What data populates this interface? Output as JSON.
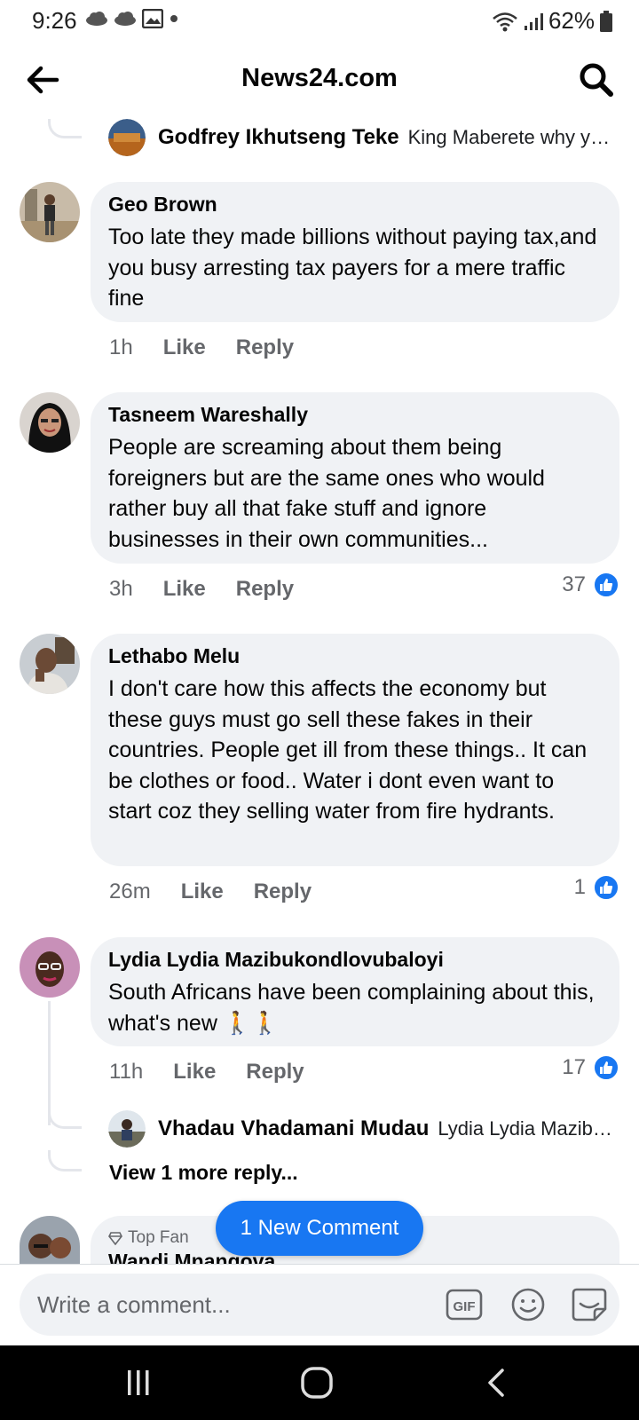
{
  "status_bar": {
    "time": "9:26",
    "battery": "62%"
  },
  "header": {
    "title": "News24.com"
  },
  "top_reply_preview": {
    "name": "Godfrey Ikhutseng Teke",
    "text": "King Maberete why yo…"
  },
  "comments": [
    {
      "author": "Geo Brown",
      "text": "Too late they made billions without paying tax,and you busy arresting tax payers for a mere traffic fine",
      "time": "1h",
      "like_label": "Like",
      "reply_label": "Reply",
      "reactions": ""
    },
    {
      "author": "Tasneem Wareshally",
      "text": "People are screaming about them being foreigners but are the same ones who would rather buy all that fake stuff and ignore businesses in their own communities...",
      "time": "3h",
      "like_label": "Like",
      "reply_label": "Reply",
      "reactions": "37"
    },
    {
      "author": "Lethabo Melu",
      "text": "I don't care how this affects the economy but these guys must go sell these fakes in their countries. People get ill from these things.. It can be clothes or food.. Water i dont even want to start coz they selling water from fire hydrants.",
      "time": "26m",
      "like_label": "Like",
      "reply_label": "Reply",
      "reactions": "1"
    },
    {
      "author": "Lydia Lydia Mazibukondlovubaloyi",
      "text": "South Africans have been complaining about this, what's new 🚶🚶",
      "time": "11h",
      "like_label": "Like",
      "reply_label": "Reply",
      "reactions": "17"
    }
  ],
  "nested_reply_preview": {
    "name": "Vhadau Vhadamani Mudau",
    "text": "Lydia Lydia Mazibu…"
  },
  "view_more_replies": "View 1 more reply...",
  "new_comment_pill": "1 New Comment",
  "partial_comment": {
    "badge": "Top Fan",
    "author": "Wandi Mnangova"
  },
  "composer": {
    "placeholder": "Write a comment..."
  },
  "colors": {
    "accent": "#1877f2",
    "bubble": "#f0f2f5",
    "meta_text": "#65676b"
  }
}
